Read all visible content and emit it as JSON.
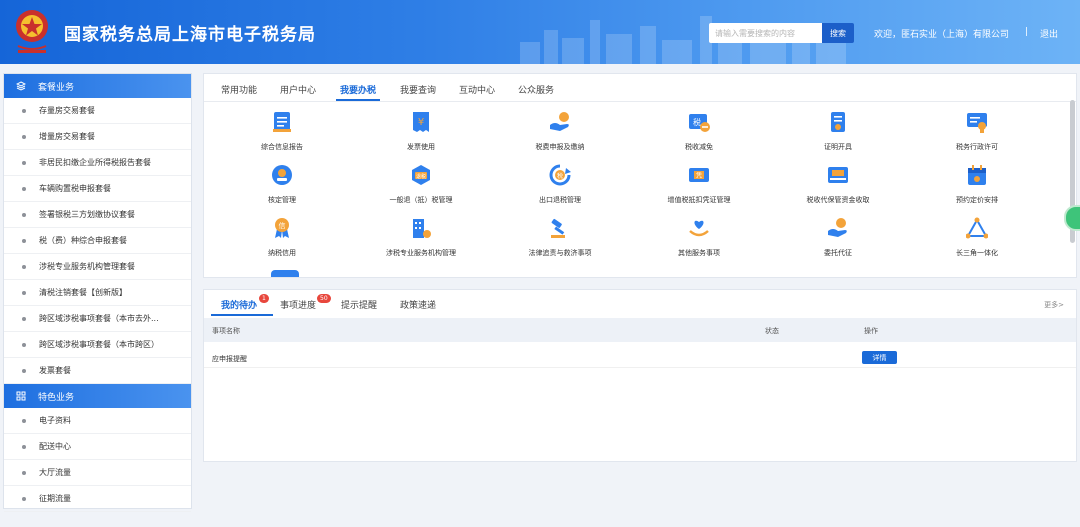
{
  "header": {
    "title": "国家税务总局上海市电子税务局",
    "search_placeholder": "请输入需要搜索的内容",
    "search_button": "搜索",
    "welcome": "欢迎，匪石实业（上海）有限公司",
    "separator": "|",
    "logout": "退出"
  },
  "sidebar": {
    "section1": "套餐业务",
    "items1": [
      "存量房交易套餐",
      "增量房交易套餐",
      "非居民扣缴企业所得税报告套餐",
      "车辆购置税申报套餐",
      "签署银税三方划缴协议套餐",
      "税（费）种综合申报套餐",
      "涉税专业服务机构管理套餐",
      "清税注销套餐【创新版】",
      "跨区域涉税事项套餐（本市去外...",
      "跨区域涉税事项套餐（本市跨区）",
      "发票套餐"
    ],
    "section2": "特色业务",
    "items2": [
      "电子资料",
      "配送中心",
      "大厅流量",
      "征期流量"
    ]
  },
  "tabs": [
    "常用功能",
    "用户中心",
    "我要办税",
    "我要查询",
    "互动中心",
    "公众服务"
  ],
  "active_tab": "我要办税",
  "services": [
    {
      "label": "综合信息报告",
      "icon": "report-icon"
    },
    {
      "label": "发票使用",
      "icon": "invoice-icon"
    },
    {
      "label": "税费申报及缴纳",
      "icon": "tax-payment-icon"
    },
    {
      "label": "税收减免",
      "icon": "tax-relief-icon"
    },
    {
      "label": "证明开具",
      "icon": "certificate-icon"
    },
    {
      "label": "税务行政许可",
      "icon": "permit-icon"
    },
    {
      "label": "核定管理",
      "icon": "assessment-icon"
    },
    {
      "label": "一般退（抵）税管理",
      "icon": "refund-icon"
    },
    {
      "label": "出口退税管理",
      "icon": "export-refund-icon"
    },
    {
      "label": "增值税抵扣凭证管理",
      "icon": "voucher-icon"
    },
    {
      "label": "税收代保管资金收取",
      "icon": "custody-fund-icon"
    },
    {
      "label": "预约定价安排",
      "icon": "calendar-icon"
    },
    {
      "label": "纳税信用",
      "icon": "credit-medal-icon"
    },
    {
      "label": "涉税专业服务机构管理",
      "icon": "agency-building-icon"
    },
    {
      "label": "法律追责与救济事项",
      "icon": "gavel-icon"
    },
    {
      "label": "其他服务事项",
      "icon": "heart-hand-icon"
    },
    {
      "label": "委托代征",
      "icon": "delegation-icon"
    },
    {
      "label": "长三角一体化",
      "icon": "triangle-network-icon"
    }
  ],
  "bottom_tabs": [
    {
      "label": "我的待办",
      "badge": "1"
    },
    {
      "label": "事项进度",
      "badge": "50"
    },
    {
      "label": "提示提醒",
      "badge": ""
    },
    {
      "label": "政策速递",
      "badge": ""
    }
  ],
  "more": "更多>",
  "table": {
    "headers": [
      "事项名称",
      "状态",
      "操作"
    ],
    "rows": [
      {
        "name": "应申报提醒",
        "status": "",
        "action": "详情"
      }
    ]
  },
  "colors": {
    "primary": "#1a6ad8",
    "header_start": "#1565d8",
    "badge": "#e8473d",
    "float": "#3ec47a"
  }
}
